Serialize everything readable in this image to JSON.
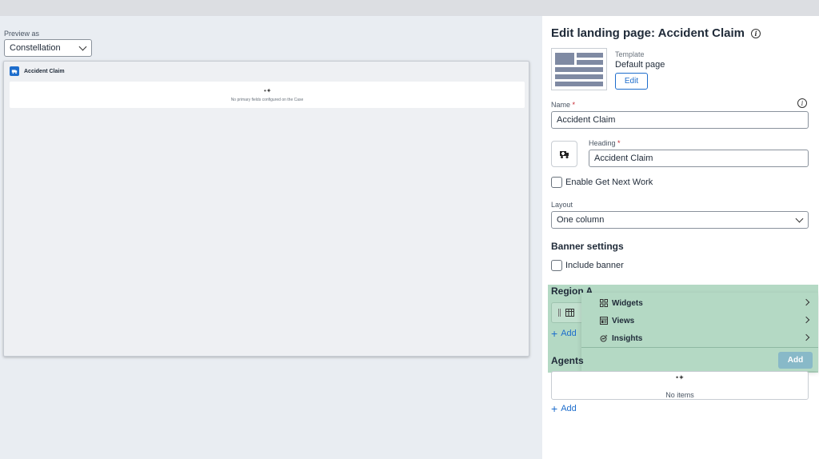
{
  "preview": {
    "label": "Preview as",
    "selected": "Constellation",
    "canvas": {
      "case_title": "Accident Claim",
      "empty_message": "No primary fields configured on the Case"
    }
  },
  "panel": {
    "title": "Edit landing page: Accident Claim",
    "template": {
      "label": "Template",
      "value": "Default page",
      "edit_label": "Edit"
    },
    "name": {
      "label": "Name",
      "required_mark": "*",
      "value": "Accident Claim"
    },
    "heading": {
      "label": "Heading",
      "required_mark": "*",
      "value": "Accident Claim"
    },
    "get_next_work": {
      "label": "Enable Get Next Work",
      "checked": false
    },
    "layout": {
      "label": "Layout",
      "value": "One column"
    },
    "banner": {
      "title": "Banner settings",
      "include_label": "Include banner",
      "checked": false
    },
    "region_a": {
      "title": "Region A",
      "add_label": "Add"
    },
    "add_menu": {
      "items": [
        {
          "label": "Widgets",
          "icon": "widgets-icon"
        },
        {
          "label": "Views",
          "icon": "views-icon"
        },
        {
          "label": "Insights",
          "icon": "insights-icon"
        }
      ],
      "add_button": "Add"
    },
    "agents": {
      "title": "Agents",
      "empty": "No items",
      "add_label": "Add"
    }
  },
  "colors": {
    "accent": "#1d6dcc",
    "highlight": "#b4d9c4",
    "required": "#c5242d"
  }
}
